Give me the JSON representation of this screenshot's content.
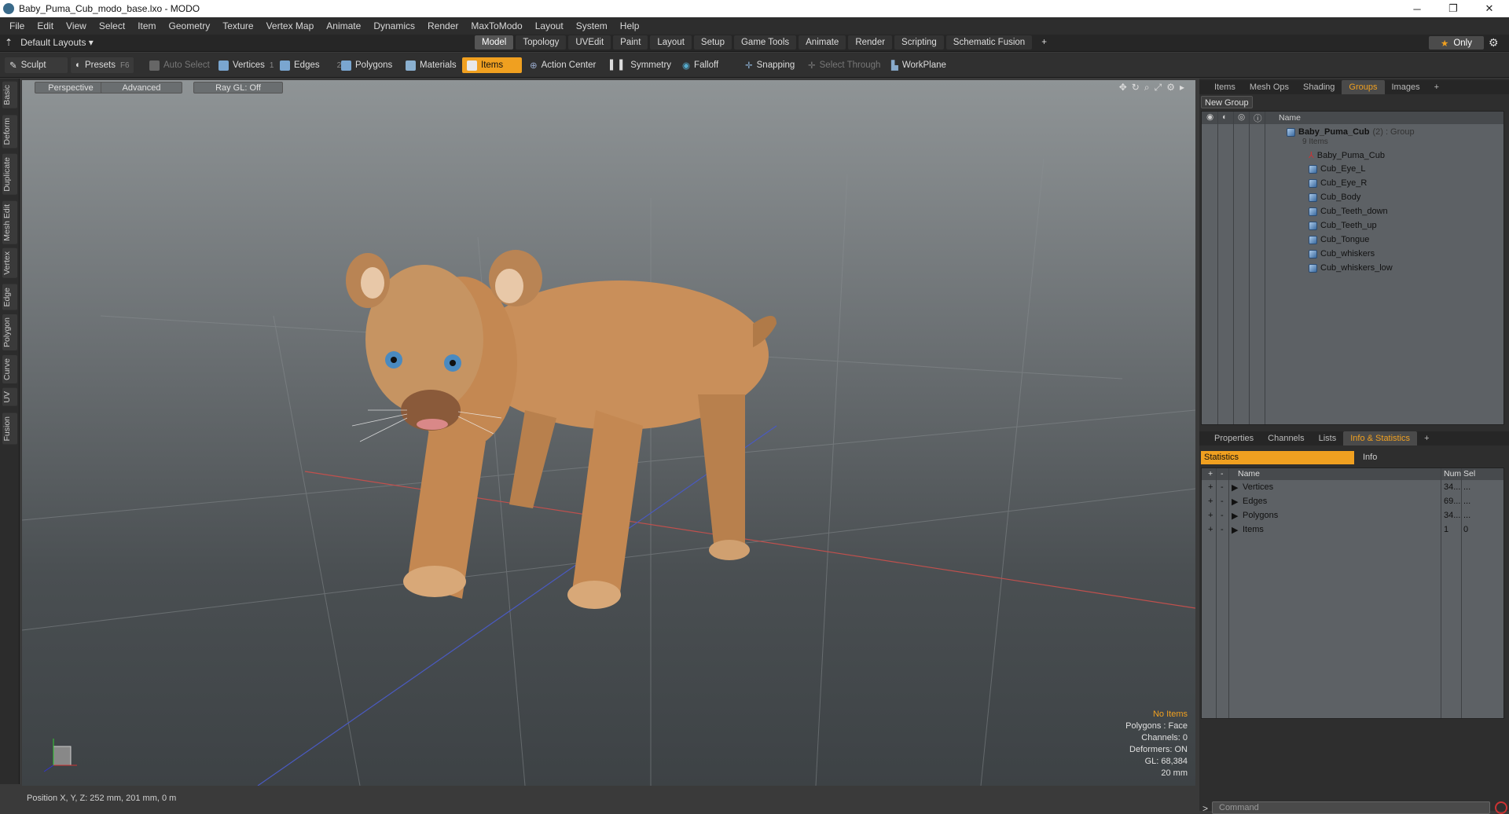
{
  "window": {
    "title": "Baby_Puma_Cub_modo_base.lxo - MODO"
  },
  "menu": [
    "File",
    "Edit",
    "View",
    "Select",
    "Item",
    "Geometry",
    "Texture",
    "Vertex Map",
    "Animate",
    "Dynamics",
    "Render",
    "MaxToModo",
    "Layout",
    "System",
    "Help"
  ],
  "layout": {
    "name": "Default Layouts ▾",
    "tabs": [
      "Model",
      "Topology",
      "UVEdit",
      "Paint",
      "Layout",
      "Setup",
      "Game Tools",
      "Animate",
      "Render",
      "Scripting",
      "Schematic Fusion"
    ],
    "active_tab": "Model",
    "add": "+",
    "only": "Only"
  },
  "toolbar": {
    "sculpt": "Sculpt",
    "presets": "Presets",
    "presets_key": "F6",
    "auto_select": "Auto Select",
    "vertices": "Vertices",
    "vertices_key": "1",
    "edges": "Edges",
    "edges_key": "2",
    "polygons": "Polygons",
    "materials": "Materials",
    "items": "Items",
    "action_center": "Action Center",
    "symmetry": "Symmetry",
    "falloff": "Falloff",
    "snapping": "Snapping",
    "select_through": "Select Through",
    "workplane": "WorkPlane"
  },
  "left_tabs": [
    "Basic",
    "Deform",
    "Duplicate",
    "Mesh Edit",
    "Vertex",
    "Edge",
    "Polygon",
    "Curve",
    "UV",
    "Fusion"
  ],
  "viewport": {
    "perspective": "Perspective",
    "advanced": "Advanced",
    "raygl": "Ray GL: Off",
    "info": {
      "no_items": "No Items",
      "polygons": "Polygons : Face",
      "channels": "Channels: 0",
      "deformers": "Deformers: ON",
      "gl": "GL: 68,384",
      "scale": "20 mm"
    }
  },
  "status": {
    "position": "Position X, Y, Z:   252 mm, 201 mm, 0 m"
  },
  "groups_panel": {
    "tabs": [
      "Items",
      "Mesh Ops",
      "Shading",
      "Groups",
      "Images"
    ],
    "active": "Groups",
    "add": "+",
    "new_group": "New Group",
    "col_name": "Name",
    "group": {
      "name": "Baby_Puma_Cub",
      "count": "(2)",
      "type": ": Group",
      "items_count": "9 Items"
    },
    "items": [
      "Baby_Puma_Cub",
      "Cub_Eye_L",
      "Cub_Eye_R",
      "Cub_Body",
      "Cub_Teeth_down",
      "Cub_Teeth_up",
      "Cub_Tongue",
      "Cub_whiskers",
      "Cub_whiskers_low"
    ]
  },
  "info_panel": {
    "tabs": [
      "Properties",
      "Channels",
      "Lists",
      "Info & Statistics"
    ],
    "active": "Info & Statistics",
    "add": "+",
    "statistics": "Statistics",
    "info": "Info",
    "headers": {
      "name": "Name",
      "num": "Num",
      "sel": "Sel"
    },
    "rows": [
      {
        "name": "Vertices",
        "num": "34...",
        "sel": "..."
      },
      {
        "name": "Edges",
        "num": "69...",
        "sel": "..."
      },
      {
        "name": "Polygons",
        "num": "34...",
        "sel": "..."
      },
      {
        "name": "Items",
        "num": "1",
        "sel": "0"
      }
    ],
    "command_placeholder": "Command"
  }
}
